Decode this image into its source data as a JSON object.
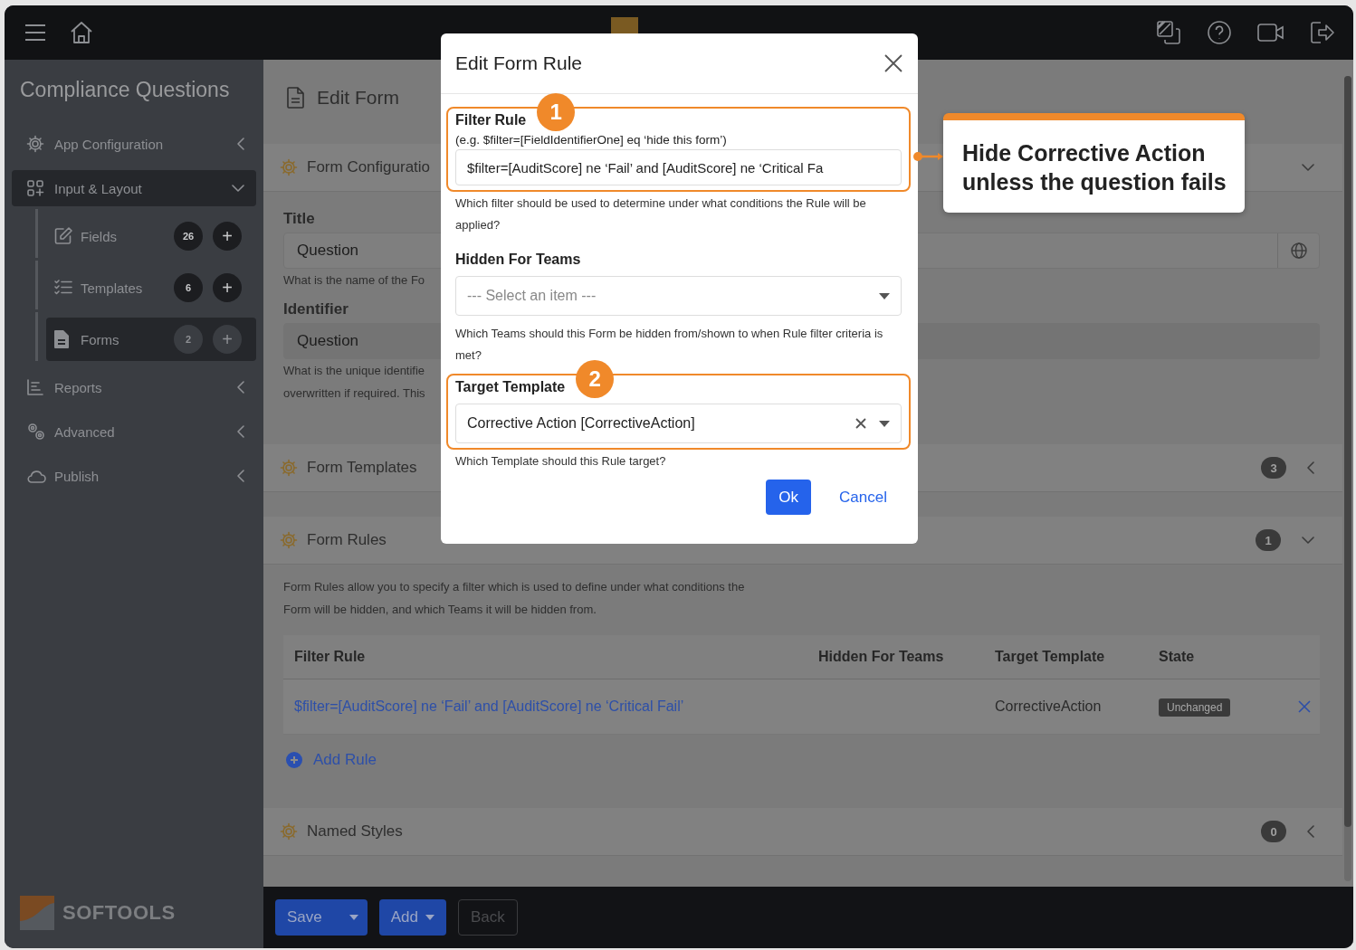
{
  "sidebar": {
    "title": "Compliance Questions",
    "brand": "SOFTOOLS",
    "items": [
      {
        "label": "App Configuration",
        "expanded": false,
        "selected": false
      },
      {
        "label": "Input & Layout",
        "expanded": true,
        "selected": true,
        "children": [
          {
            "label": "Fields",
            "count": "26",
            "add": "+",
            "selected": false
          },
          {
            "label": "Templates",
            "count": "6",
            "add": "+",
            "selected": false
          },
          {
            "label": "Forms",
            "count": "2",
            "add": "+",
            "selected": true
          }
        ]
      },
      {
        "label": "Reports",
        "expanded": false,
        "selected": false
      },
      {
        "label": "Advanced",
        "expanded": false,
        "selected": false
      },
      {
        "label": "Publish",
        "expanded": false,
        "selected": false
      }
    ]
  },
  "page": {
    "title": "Edit Form"
  },
  "form_configuration": {
    "title": "Form Configuratio",
    "expanded": true,
    "fields": [
      {
        "kind": "translatable",
        "label": "Title",
        "value": "Question",
        "help": [
          "What is the name of the Fo"
        ]
      },
      {
        "kind": "readonly",
        "label": "Identifier",
        "value": "Question",
        "help": [
          "What is the unique identifie",
          "overwritten if required. This"
        ]
      }
    ]
  },
  "form_templates": {
    "title": "Form Templates",
    "count": "3",
    "expanded": false
  },
  "form_rules": {
    "title": "Form Rules",
    "count": "1",
    "expanded": true,
    "description": [
      "Form Rules allow you to specify a filter which is used to define under what conditions the",
      "Form will be hidden, and which Teams it will be hidden from."
    ],
    "table": {
      "columns": [
        "Filter Rule",
        "Hidden For Teams",
        "Target Template",
        "State"
      ],
      "rows": [
        {
          "filter_rule": "$filter=[AuditScore] ne ‘Fail’ and [AuditScore] ne ‘Critical Fail’",
          "target_template": "CorrectiveAction",
          "state": "Unchanged"
        }
      ]
    },
    "add_rule": "Add Rule"
  },
  "named_styles": {
    "title": "Named Styles",
    "count": "0",
    "expanded": false
  },
  "footer": {
    "buttons": [
      {
        "label": "Save",
        "kind": "split",
        "disabled": false
      },
      {
        "label": "Add",
        "kind": "dropdown",
        "disabled": false
      },
      {
        "label": "Back",
        "kind": "plain",
        "disabled": true
      }
    ]
  },
  "dialog": {
    "title": "Edit Form Rule",
    "fields": [
      {
        "kind": "text",
        "label": "Filter Rule",
        "marker": "1",
        "hint": "(e.g. $filter=[FieldIdentifierOne] eq ‘hide this form’)",
        "value": "$filter=[AuditScore] ne ‘Fail’ and [AuditScore] ne ‘Critical Fa",
        "help": "Which filter should be used to determine under what conditions the Rule will be applied?"
      },
      {
        "kind": "select",
        "label": "Hidden For Teams",
        "placeholder": "--- Select an item ---",
        "help": "Which Teams should this Form be hidden from/shown to when Rule filter criteria is met?"
      },
      {
        "kind": "select",
        "label": "Target Template",
        "marker": "2",
        "value": "Corrective Action [CorrectiveAction]",
        "clearable": true,
        "help": "Which Template should this Rule target?"
      }
    ],
    "buttons": [
      {
        "label": "Ok",
        "kind": "primary"
      },
      {
        "label": "Cancel",
        "kind": "link"
      }
    ]
  },
  "callout": {
    "text": "Hide Corrective Action unless the question fails"
  }
}
